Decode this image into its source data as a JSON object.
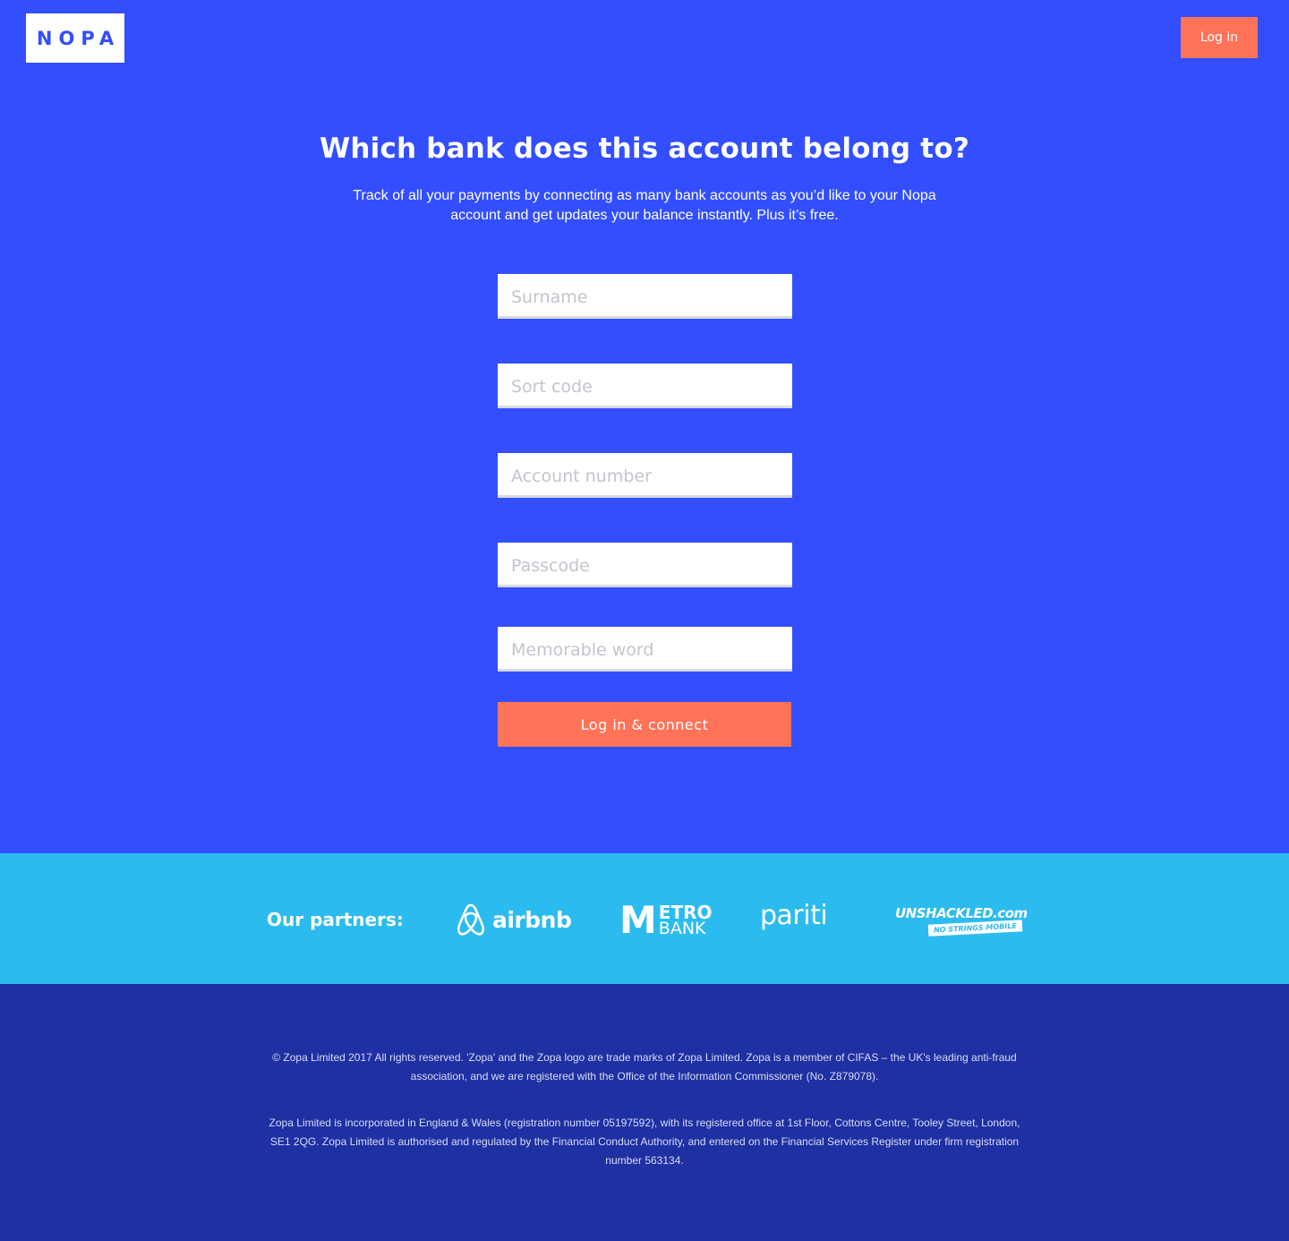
{
  "header": {
    "logo_text": "NOPA",
    "login_label": "Log in"
  },
  "main": {
    "title": "Which bank does this account belong to?",
    "subtitle": "Track of all your payments by connecting as many bank accounts as you’d like to your Nopa account and get updates your balance instantly. Plus it’s free.",
    "fields": {
      "surname": "Surname",
      "sort_code": "Sort code",
      "account_number": "Account number",
      "passcode": "Passcode",
      "memorable_word": "Memorable word"
    },
    "connect_label": "Log in & connect"
  },
  "partners": {
    "label": "Our partners:",
    "airbnb": "airbnb",
    "metro_m": "M",
    "metro_top": "ETRO",
    "metro_bottom": "BANK",
    "pariti": "pariti",
    "unshackled": "UNSHACKLED.com",
    "unshackled_tag": "NO STRINGS MOBILE"
  },
  "footer": {
    "copyright": "© Zopa Limited 2017 All rights reserved. 'Zopa' and the Zopa logo are trade marks of Zopa Limited. Zopa is a member of CIFAS – the UK's leading anti-fraud association, and we are registered with the Office of the Information Commissioner (No. Z879078).",
    "registration": "Zopa Limited is incorporated in England & Wales (registration number 05197592), with its registered office at 1st Floor, Cottons Centre, Tooley Street, London, SE1 2QG. Zopa Limited is authorised and regulated by the Financial Conduct Authority, and entered on the Financial Services Register under firm registration number 563134."
  },
  "colors": {
    "primary_blue": "#334eff",
    "accent_orange": "#ff7358",
    "partners_bg": "#2cbbef",
    "footer_bg": "#1e30a2"
  }
}
